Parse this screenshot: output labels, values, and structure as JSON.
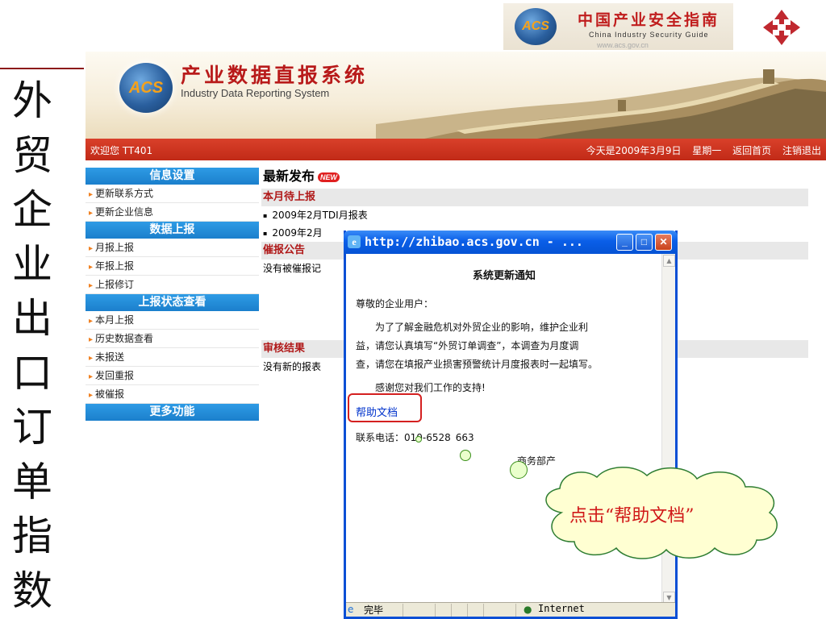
{
  "slide": {
    "banner_title": "中国产业安全指南",
    "banner_subtitle": "China Industry Security Guide",
    "banner_url": "www.acs.gov.cn",
    "acs_logo_text": "ACS",
    "side_title": [
      "外",
      "贸",
      "企",
      "业",
      "出",
      "口",
      "订",
      "单",
      "指",
      "数"
    ]
  },
  "header": {
    "logo_text": "ACS",
    "title": "产业数据直报系统",
    "subtitle": "Industry Data Reporting System"
  },
  "topbar": {
    "welcome": "欢迎您 TT401",
    "date": "今天是2009年3月9日",
    "weekday": "星期一",
    "home_link": "返回首页",
    "logout_link": "注销退出"
  },
  "sidebar": {
    "sections": [
      {
        "title": "信息设置",
        "items": [
          "更新联系方式",
          "更新企业信息"
        ]
      },
      {
        "title": "数据上报",
        "items": [
          "月报上报",
          "年报上报",
          "上报修订"
        ]
      },
      {
        "title": "上报状态查看",
        "items": [
          "本月上报",
          "历史数据查看",
          "未报送",
          "发回重报",
          "被催报"
        ]
      },
      {
        "title": "更多功能",
        "items": []
      }
    ]
  },
  "main": {
    "title": "最新发布",
    "new_badge": "NEW",
    "pending_head": "本月待上报",
    "pending_items": [
      "2009年2月TDI月报表",
      "2009年2月"
    ],
    "urge_head": "催报公告",
    "urge_text": "没有被催报记",
    "audit_head": "审核结果",
    "audit_text": "没有新的报表"
  },
  "popup": {
    "title": "http://zhibao.acs.gov.cn - ...",
    "notice_title": "系统更新通知",
    "greeting": "尊敬的企业用户：",
    "body_lines": [
      "为了了解金融危机对外贸企业的影响，维护企业利",
      "益，请您认真填写“外贸订单调查”，本调查为月度调",
      "查，请您在填报产业损害预警统计月度报表时一起填写。"
    ],
    "thanks": "感谢您对我们工作的支持!",
    "help_link": "帮助文档",
    "phone_label": "联系电话：010-6528",
    "phone_tail": "663",
    "org": "商务部产",
    "status_done": "完毕",
    "status_zone": "Internet"
  },
  "callout": {
    "text": "点击“帮助文档”"
  }
}
